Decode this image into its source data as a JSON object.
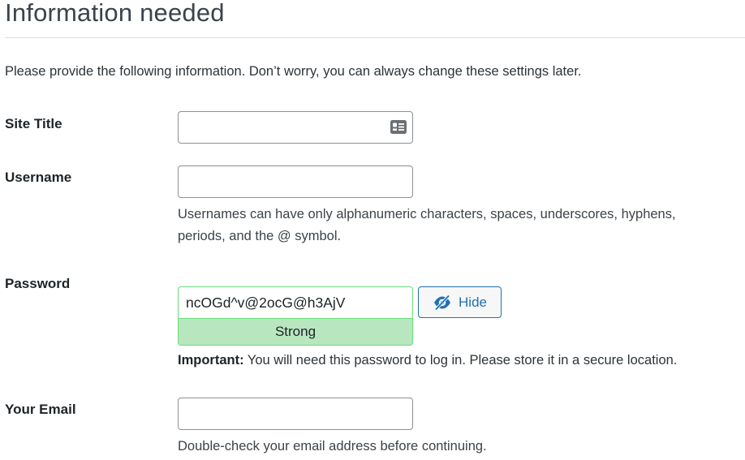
{
  "page": {
    "title": "Information needed",
    "intro": "Please provide the following information. Don’t worry, you can always change these settings later."
  },
  "fields": {
    "site_title": {
      "label": "Site Title",
      "value": "",
      "autofill_icon": "contact-card-icon"
    },
    "username": {
      "label": "Username",
      "value": "",
      "help_line1": "Usernames can have only alphanumeric characters, spaces, underscores, hyphens,",
      "help_line2": "periods, and the @ symbol."
    },
    "password": {
      "label": "Password",
      "value": "ncOGd^v@2ocG@h3AjV",
      "strength": "Strong",
      "toggle_label": "Hide",
      "toggle_icon": "eye-slash-icon",
      "important_label": "Important:",
      "important_text": " You will need this password to log in. Please store it in a secure location."
    },
    "email": {
      "label": "Your Email",
      "value": "",
      "help": "Double-check your email address before continuing."
    }
  },
  "colors": {
    "accent": "#2271b1",
    "strength_bg": "#b8e6bf",
    "strength_border": "#68de7c"
  }
}
